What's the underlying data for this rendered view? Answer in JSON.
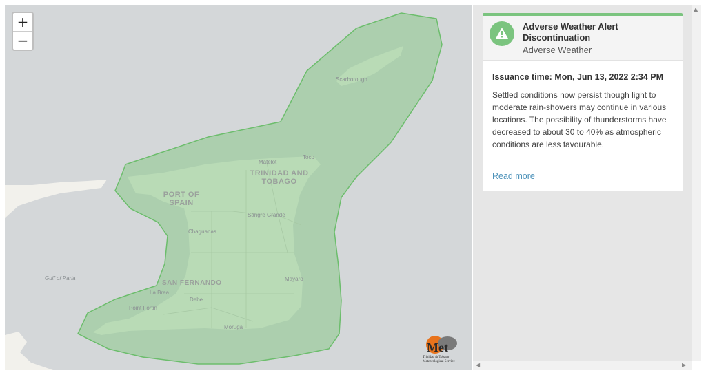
{
  "map": {
    "zoom_in_label": "+",
    "zoom_out_label": "−",
    "labels": {
      "scarborough": "Scarborough",
      "matelot": "Matelot",
      "toco": "Toco",
      "country_line1": "TRINIDAD AND",
      "country_line2": "TOBAGO",
      "pos_line1": "PORT OF",
      "pos_line2": "SPAIN",
      "sangre_grande": "Sangre Grande",
      "chaguanas": "Chaguanas",
      "gulf_of_paria": "Gulf of Paria",
      "san_fernando": "SAN FERNANDO",
      "mayaro": "Mayaro",
      "la_brea": "La Brea",
      "point_fortin": "Point Fortin",
      "debe": "Debe",
      "moruga": "Moruga"
    },
    "logo": {
      "text": "Met",
      "caption_line1": "Trinidad & Tobago",
      "caption_line2": "Meteorological Service"
    },
    "colors": {
      "sea": "#d4d7d9",
      "land": "#f2f1ec",
      "alert_fill": "#8ac98a",
      "alert_stroke": "#6cbd6c"
    }
  },
  "alert": {
    "title": "Adverse Weather Alert Discontinuation",
    "category": "Adverse Weather",
    "issuance": "Issuance time: Mon, Jun 13, 2022 2:34 PM",
    "body": "Settled conditions now persist though light to moderate rain-showers may continue in various locations. The possibility of thunderstorms have decreased to about 30 to 40% as atmospheric conditions are less favourable.",
    "read_more": "Read more",
    "accent_color": "#7bc47f"
  }
}
